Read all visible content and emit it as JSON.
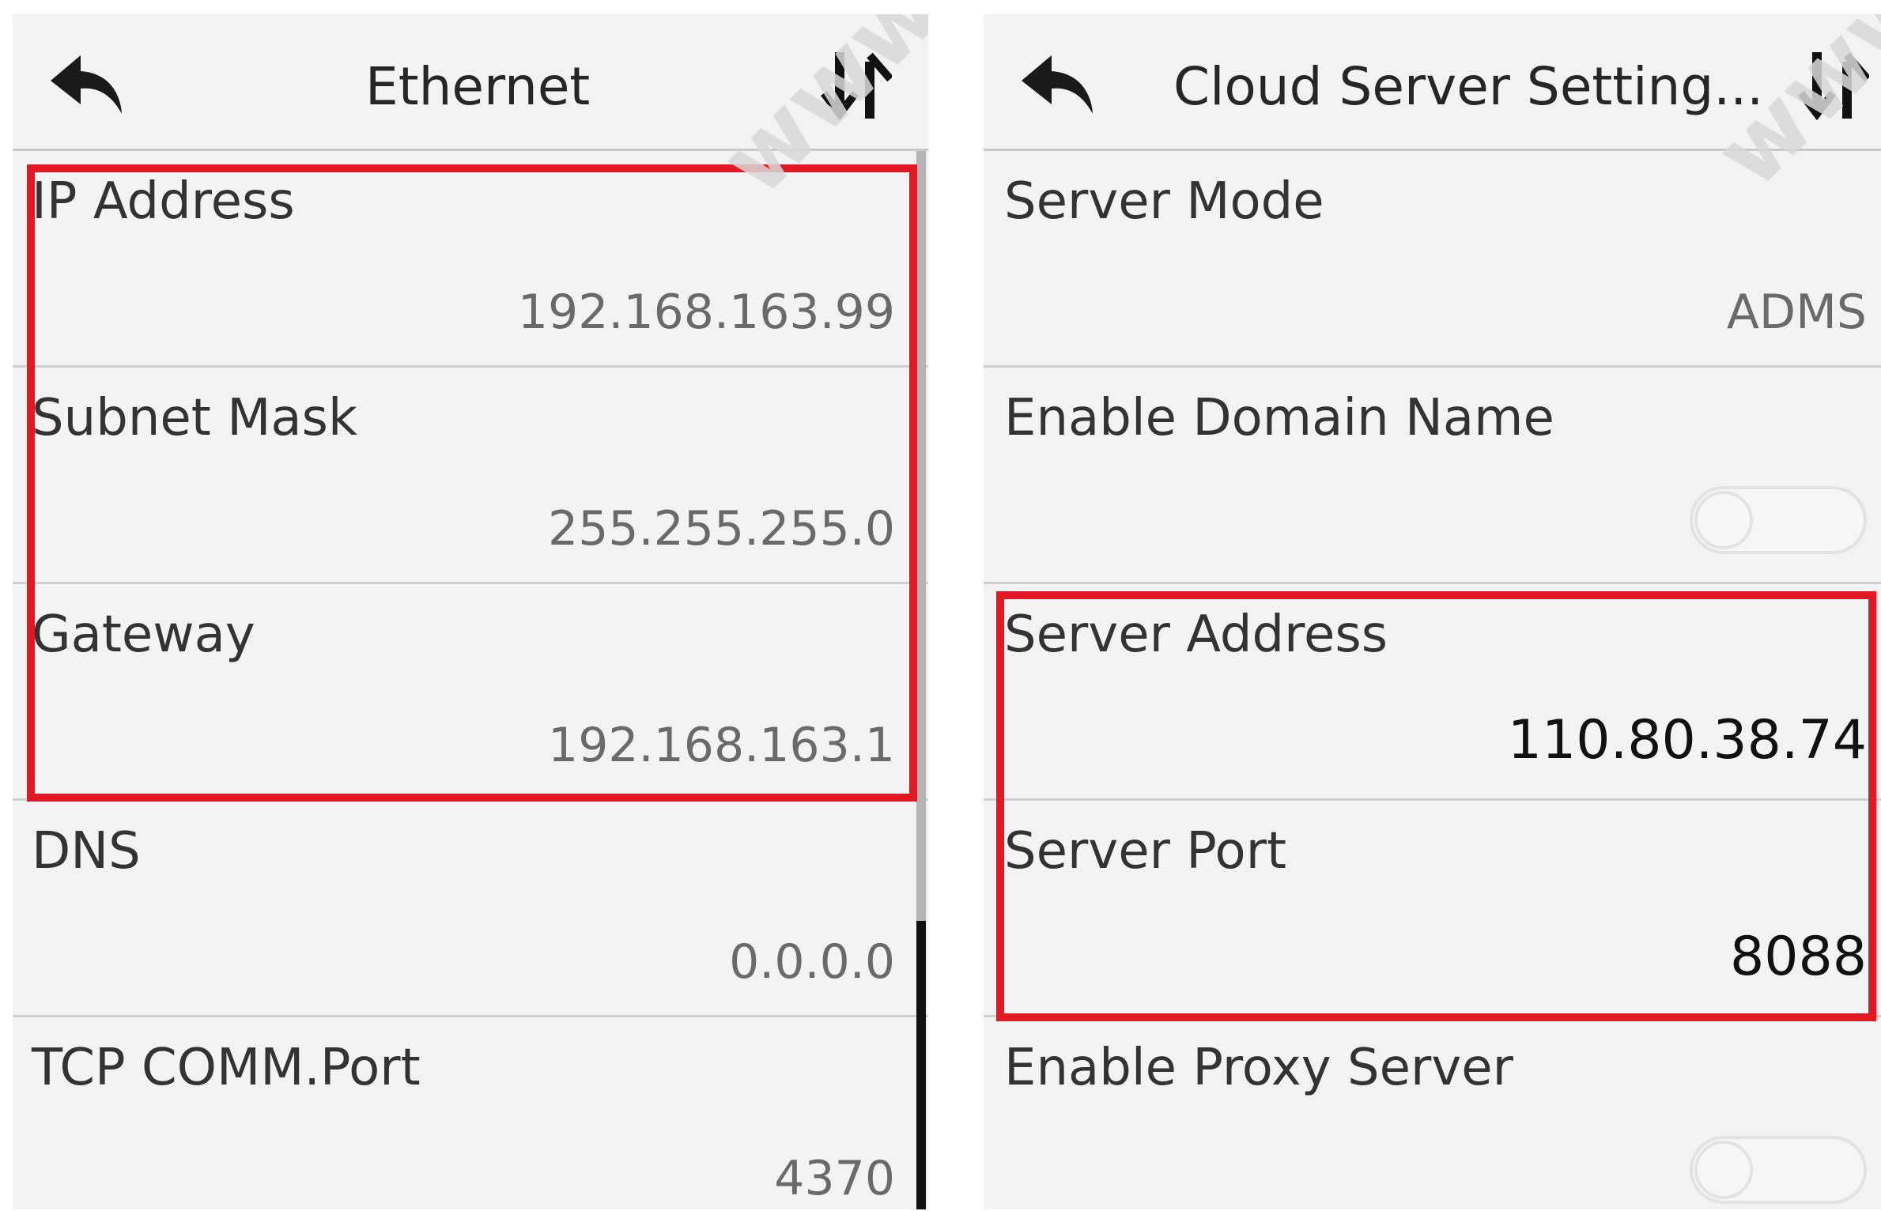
{
  "watermark": "www",
  "colors": {
    "highlight": "#e01924",
    "panel": "#f3f3f3",
    "divider": "#cfcfcf"
  },
  "ethernet": {
    "title": "Ethernet",
    "back_icon": "back-arrow-icon",
    "sort_icon": "sort-arrows-icon",
    "rows": [
      {
        "label": "IP Address",
        "value": "192.168.163.99"
      },
      {
        "label": "Subnet Mask",
        "value": "255.255.255.0"
      },
      {
        "label": "Gateway",
        "value": "192.168.163.1"
      },
      {
        "label": "DNS",
        "value": "0.0.0.0"
      },
      {
        "label": "TCP COMM.Port",
        "value": "4370"
      }
    ]
  },
  "cloud": {
    "title": "Cloud Server Setting...",
    "back_icon": "back-arrow-icon",
    "sort_icon": "sort-arrows-icon",
    "rows": [
      {
        "label": "Server Mode",
        "value": "ADMS"
      },
      {
        "label": "Enable Domain Name",
        "toggle": "off"
      },
      {
        "label": "Server Address",
        "value": "110.80.38.74"
      },
      {
        "label": "Server Port",
        "value": "8088"
      },
      {
        "label": "Enable Proxy Server",
        "toggle": "off"
      }
    ]
  }
}
